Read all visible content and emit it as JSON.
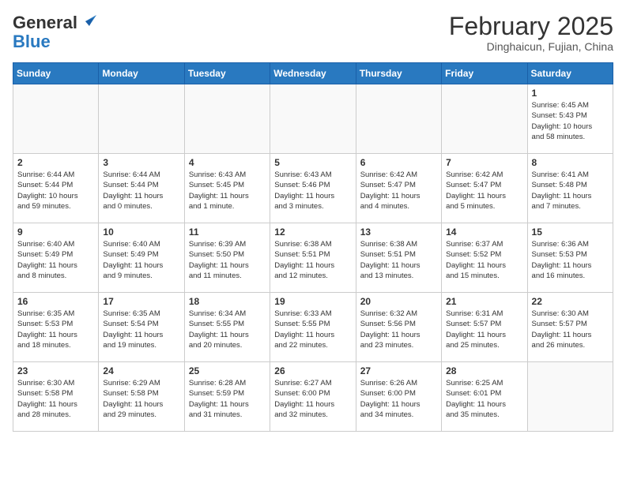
{
  "header": {
    "logo_general": "General",
    "logo_blue": "Blue",
    "month_year": "February 2025",
    "location": "Dinghaicun, Fujian, China"
  },
  "weekdays": [
    "Sunday",
    "Monday",
    "Tuesday",
    "Wednesday",
    "Thursday",
    "Friday",
    "Saturday"
  ],
  "weeks": [
    [
      {
        "day": "",
        "info": ""
      },
      {
        "day": "",
        "info": ""
      },
      {
        "day": "",
        "info": ""
      },
      {
        "day": "",
        "info": ""
      },
      {
        "day": "",
        "info": ""
      },
      {
        "day": "",
        "info": ""
      },
      {
        "day": "1",
        "info": "Sunrise: 6:45 AM\nSunset: 5:43 PM\nDaylight: 10 hours\nand 58 minutes."
      }
    ],
    [
      {
        "day": "2",
        "info": "Sunrise: 6:44 AM\nSunset: 5:44 PM\nDaylight: 10 hours\nand 59 minutes."
      },
      {
        "day": "3",
        "info": "Sunrise: 6:44 AM\nSunset: 5:44 PM\nDaylight: 11 hours\nand 0 minutes."
      },
      {
        "day": "4",
        "info": "Sunrise: 6:43 AM\nSunset: 5:45 PM\nDaylight: 11 hours\nand 1 minute."
      },
      {
        "day": "5",
        "info": "Sunrise: 6:43 AM\nSunset: 5:46 PM\nDaylight: 11 hours\nand 3 minutes."
      },
      {
        "day": "6",
        "info": "Sunrise: 6:42 AM\nSunset: 5:47 PM\nDaylight: 11 hours\nand 4 minutes."
      },
      {
        "day": "7",
        "info": "Sunrise: 6:42 AM\nSunset: 5:47 PM\nDaylight: 11 hours\nand 5 minutes."
      },
      {
        "day": "8",
        "info": "Sunrise: 6:41 AM\nSunset: 5:48 PM\nDaylight: 11 hours\nand 7 minutes."
      }
    ],
    [
      {
        "day": "9",
        "info": "Sunrise: 6:40 AM\nSunset: 5:49 PM\nDaylight: 11 hours\nand 8 minutes."
      },
      {
        "day": "10",
        "info": "Sunrise: 6:40 AM\nSunset: 5:49 PM\nDaylight: 11 hours\nand 9 minutes."
      },
      {
        "day": "11",
        "info": "Sunrise: 6:39 AM\nSunset: 5:50 PM\nDaylight: 11 hours\nand 11 minutes."
      },
      {
        "day": "12",
        "info": "Sunrise: 6:38 AM\nSunset: 5:51 PM\nDaylight: 11 hours\nand 12 minutes."
      },
      {
        "day": "13",
        "info": "Sunrise: 6:38 AM\nSunset: 5:51 PM\nDaylight: 11 hours\nand 13 minutes."
      },
      {
        "day": "14",
        "info": "Sunrise: 6:37 AM\nSunset: 5:52 PM\nDaylight: 11 hours\nand 15 minutes."
      },
      {
        "day": "15",
        "info": "Sunrise: 6:36 AM\nSunset: 5:53 PM\nDaylight: 11 hours\nand 16 minutes."
      }
    ],
    [
      {
        "day": "16",
        "info": "Sunrise: 6:35 AM\nSunset: 5:53 PM\nDaylight: 11 hours\nand 18 minutes."
      },
      {
        "day": "17",
        "info": "Sunrise: 6:35 AM\nSunset: 5:54 PM\nDaylight: 11 hours\nand 19 minutes."
      },
      {
        "day": "18",
        "info": "Sunrise: 6:34 AM\nSunset: 5:55 PM\nDaylight: 11 hours\nand 20 minutes."
      },
      {
        "day": "19",
        "info": "Sunrise: 6:33 AM\nSunset: 5:55 PM\nDaylight: 11 hours\nand 22 minutes."
      },
      {
        "day": "20",
        "info": "Sunrise: 6:32 AM\nSunset: 5:56 PM\nDaylight: 11 hours\nand 23 minutes."
      },
      {
        "day": "21",
        "info": "Sunrise: 6:31 AM\nSunset: 5:57 PM\nDaylight: 11 hours\nand 25 minutes."
      },
      {
        "day": "22",
        "info": "Sunrise: 6:30 AM\nSunset: 5:57 PM\nDaylight: 11 hours\nand 26 minutes."
      }
    ],
    [
      {
        "day": "23",
        "info": "Sunrise: 6:30 AM\nSunset: 5:58 PM\nDaylight: 11 hours\nand 28 minutes."
      },
      {
        "day": "24",
        "info": "Sunrise: 6:29 AM\nSunset: 5:58 PM\nDaylight: 11 hours\nand 29 minutes."
      },
      {
        "day": "25",
        "info": "Sunrise: 6:28 AM\nSunset: 5:59 PM\nDaylight: 11 hours\nand 31 minutes."
      },
      {
        "day": "26",
        "info": "Sunrise: 6:27 AM\nSunset: 6:00 PM\nDaylight: 11 hours\nand 32 minutes."
      },
      {
        "day": "27",
        "info": "Sunrise: 6:26 AM\nSunset: 6:00 PM\nDaylight: 11 hours\nand 34 minutes."
      },
      {
        "day": "28",
        "info": "Sunrise: 6:25 AM\nSunset: 6:01 PM\nDaylight: 11 hours\nand 35 minutes."
      },
      {
        "day": "",
        "info": ""
      }
    ]
  ]
}
